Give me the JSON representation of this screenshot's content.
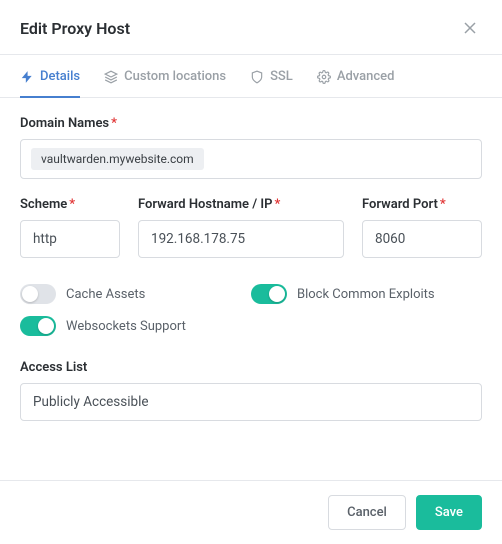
{
  "header": {
    "title": "Edit Proxy Host"
  },
  "tabs": {
    "details": "Details",
    "custom_locations": "Custom locations",
    "ssl": "SSL",
    "advanced": "Advanced"
  },
  "labels": {
    "domain_names": "Domain Names",
    "scheme": "Scheme",
    "forward_host": "Forward Hostname / IP",
    "forward_port": "Forward Port",
    "cache_assets": "Cache Assets",
    "block_exploits": "Block Common Exploits",
    "websockets": "Websockets Support",
    "access_list": "Access List"
  },
  "values": {
    "domain_tag": "vaultwarden.mywebsite.com",
    "scheme": "http",
    "forward_host": "192.168.178.75",
    "forward_port": "8060",
    "access_list": "Publicly Accessible"
  },
  "toggles": {
    "cache_assets": false,
    "block_exploits": true,
    "websockets": true
  },
  "footer": {
    "cancel": "Cancel",
    "save": "Save"
  }
}
